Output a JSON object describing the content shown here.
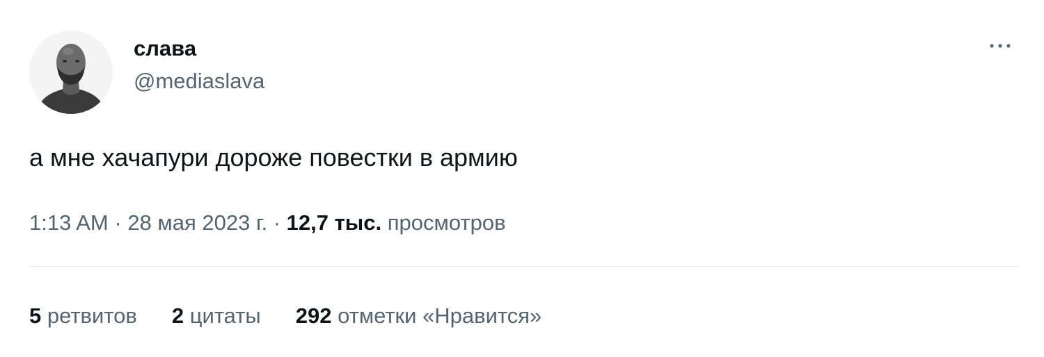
{
  "user": {
    "display_name": "слава",
    "handle": "@mediaslava",
    "avatar_icon": "profile-photo"
  },
  "menu": {
    "icon": "more-horizontal-icon"
  },
  "tweet": {
    "text": "а мне хачапури дороже повестки в армию"
  },
  "meta": {
    "time": "1:13 AM",
    "separator": "·",
    "date": "28 мая 2023 г.",
    "views_count": "12,7 тыс.",
    "views_label": "просмотров"
  },
  "stats": {
    "retweets_count": "5",
    "retweets_label": "ретвитов",
    "quotes_count": "2",
    "quotes_label": "цитаты",
    "likes_count": "292",
    "likes_label": "отметки «Нравится»"
  },
  "colors": {
    "text_primary": "#0f1419",
    "text_secondary": "#536471",
    "divider": "#e6e9eb"
  }
}
